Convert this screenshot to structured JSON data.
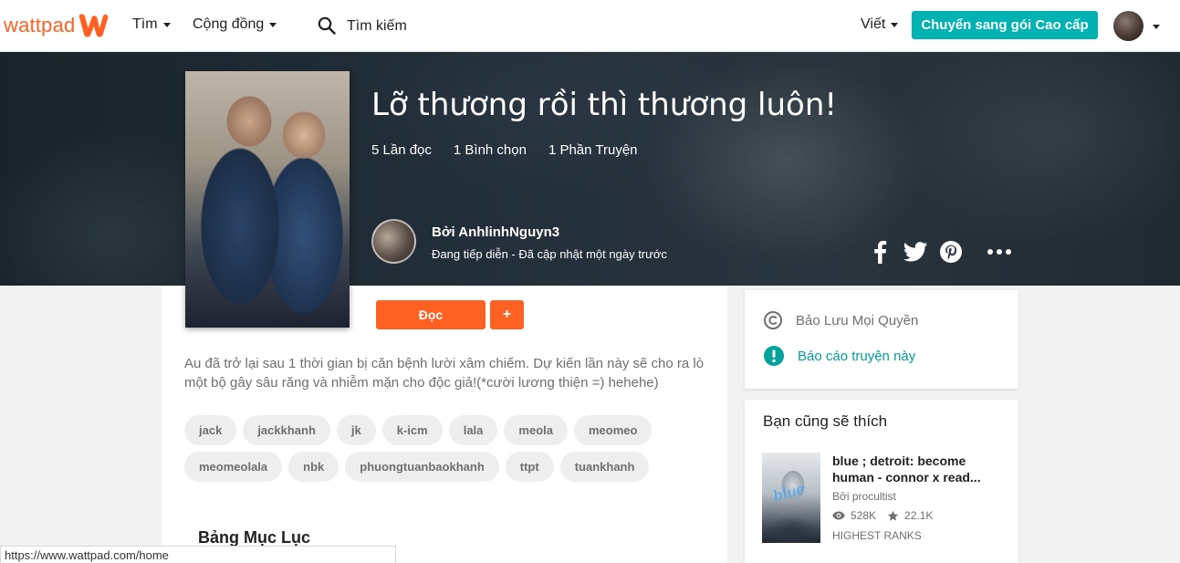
{
  "colors": {
    "brand_orange": "#ff6122",
    "teal": "#00b2b2",
    "text_dark": "#222222",
    "text_muted": "#6f6f6f"
  },
  "nav": {
    "logo_text": "wattpad",
    "browse_label": "Tìm",
    "community_label": "Cộng đồng",
    "search_placeholder": "Tìm kiếm",
    "write_label": "Viết",
    "premium_label": "Chuyển sang gói Cao cấp"
  },
  "story": {
    "title": "Lỡ thương rồi thì thương luôn!",
    "reads": "5 Lần đọc",
    "votes": "1 Bình chọn",
    "parts": "1 Phần Truyện",
    "author_line": "Bởi AnhlinhNguyn3",
    "status_line": "Đang tiếp diễn - Đã cập nhật một ngày trước",
    "read_button": "Đọc",
    "add_button": "+",
    "description": "Au đã trở lại sau 1 thời gian bị căn bệnh lười xâm chiếm. Dự kiến lần này sẽ cho ra lò một bộ gây sâu răng và nhiễm mặn cho độc giả!(*cười lương thiện =) hehehe)",
    "tags": [
      "jack",
      "jackkhanh",
      "jk",
      "k-icm",
      "lala",
      "meola",
      "meomeo",
      "meomeolala",
      "nbk",
      "phuongtuanbaokhanh",
      "ttpt",
      "tuankhanh"
    ],
    "toc_title": "Bảng Mục Lục"
  },
  "sidebar": {
    "rights_label": "Bảo Lưu Mọi Quyền",
    "report_label": "Báo cáo truyện này",
    "recs_title": "Bạn cũng sẽ thích",
    "rec": {
      "cover_word": "blue",
      "title": "blue ; detroit: become human - connor x read...",
      "author": "Bởi procultist",
      "views": "528K",
      "votes": "22.1K",
      "ranks": "HIGHEST RANKS"
    }
  },
  "status_bar": {
    "url": "https://www.wattpad.com/home"
  }
}
